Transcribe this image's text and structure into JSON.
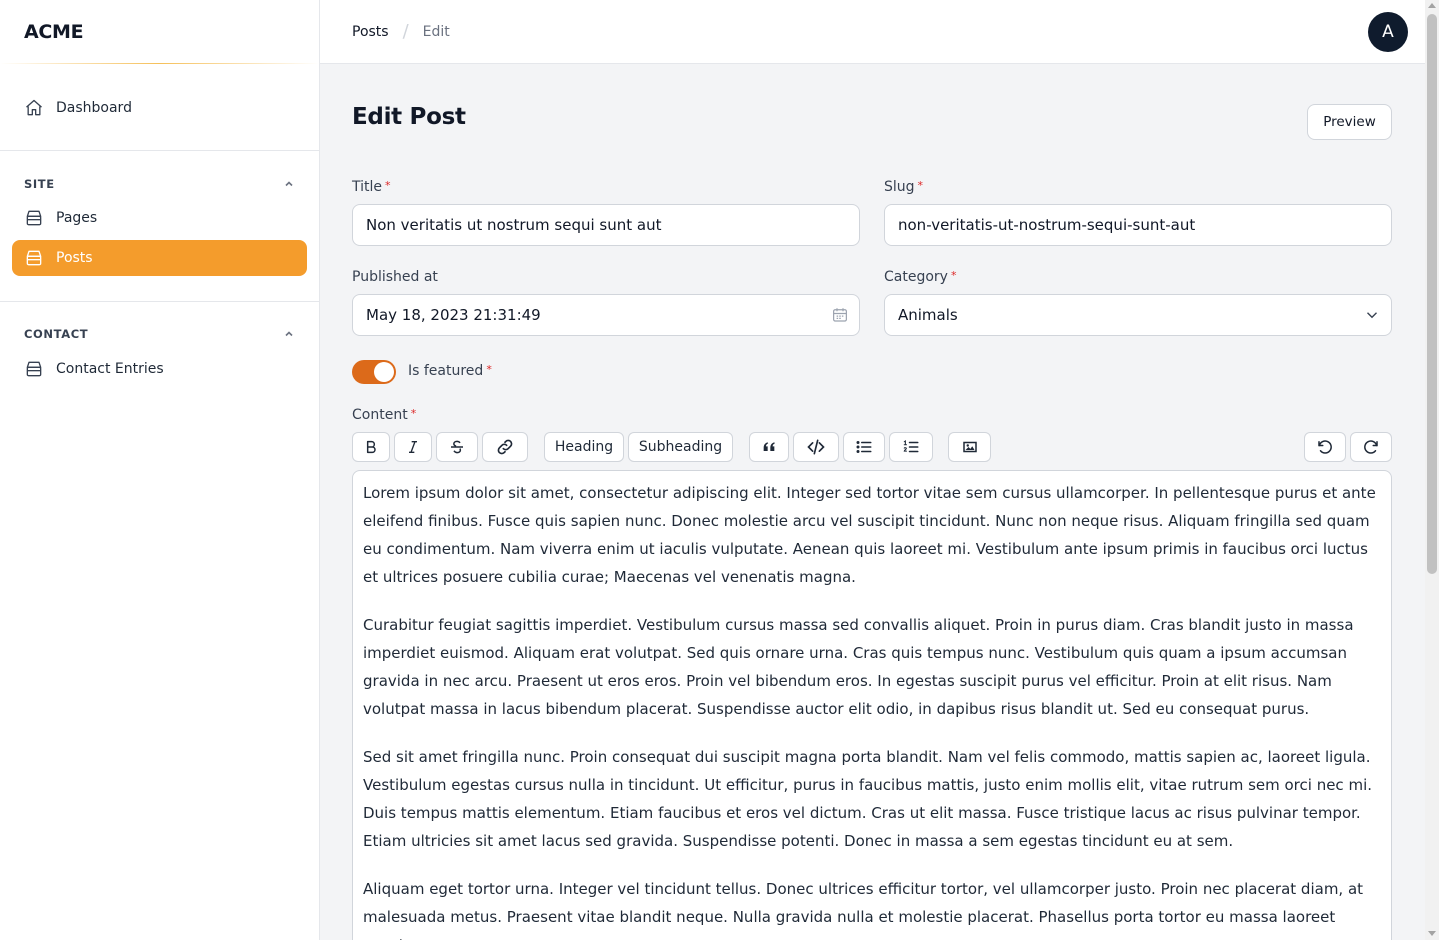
{
  "brand": "ACME",
  "sidebar": {
    "top_items": [
      {
        "label": "Dashboard",
        "icon": "home-icon"
      }
    ],
    "groups": [
      {
        "label": "SITE",
        "items": [
          {
            "label": "Pages",
            "icon": "archive-icon"
          },
          {
            "label": "Posts",
            "icon": "archive-icon",
            "active": true
          }
        ]
      },
      {
        "label": "CONTACT",
        "items": [
          {
            "label": "Contact Entries",
            "icon": "archive-icon"
          }
        ]
      }
    ]
  },
  "breadcrumb": {
    "items": [
      "Posts",
      "Edit"
    ]
  },
  "user": {
    "avatar_initial": "A"
  },
  "page": {
    "title": "Edit Post",
    "preview_label": "Preview"
  },
  "form": {
    "title": {
      "label": "Title",
      "value": "Non veritatis ut nostrum sequi sunt aut"
    },
    "slug": {
      "label": "Slug",
      "value": "non-veritatis-ut-nostrum-sequi-sunt-aut"
    },
    "published_at": {
      "label": "Published at",
      "value": "May 18, 2023 21:31:49"
    },
    "category": {
      "label": "Category",
      "value": "Animals"
    },
    "is_featured": {
      "label": "Is featured",
      "value": true
    },
    "content": {
      "label": "Content",
      "toolbar": {
        "heading_label": "Heading",
        "subheading_label": "Subheading"
      },
      "paragraphs": [
        "Lorem ipsum dolor sit amet, consectetur adipiscing elit. Integer sed tortor vitae sem cursus ullamcorper. In pellentesque purus et ante eleifend finibus. Fusce quis sapien nunc. Donec molestie arcu vel suscipit tincidunt. Nunc non neque risus. Aliquam fringilla sed quam eu condimentum. Nam viverra enim ut iaculis vulputate. Aenean quis laoreet mi. Vestibulum ante ipsum primis in faucibus orci luctus et ultrices posuere cubilia curae; Maecenas vel venenatis magna.",
        "Curabitur feugiat sagittis imperdiet. Vestibulum cursus massa sed convallis aliquet. Proin in purus diam. Cras blandit justo in massa imperdiet euismod. Aliquam erat volutpat. Sed quis ornare urna. Cras quis tempus nunc. Vestibulum quis quam a ipsum accumsan gravida in nec arcu. Praesent ut eros eros. Proin vel bibendum eros. In egestas suscipit purus vel efficitur. Proin at elit risus. Nam volutpat massa in lacus bibendum placerat. Suspendisse auctor elit odio, in dapibus risus blandit ut. Sed eu consequat purus.",
        "Sed sit amet fringilla nunc. Proin consequat dui suscipit magna porta blandit. Nam vel felis commodo, mattis sapien ac, laoreet ligula. Vestibulum egestas cursus nulla in tincidunt. Ut efficitur, purus in faucibus mattis, justo enim mollis elit, vitae rutrum sem orci nec mi. Duis tempus mattis elementum. Etiam faucibus et eros vel dictum. Cras ut elit massa. Fusce tristique lacus ac risus pulvinar tempor. Etiam ultricies sit amet lacus sed gravida. Suspendisse potenti. Donec in massa a sem egestas tincidunt eu at sem.",
        "Aliquam eget tortor urna. Integer vel tincidunt tellus. Donec ultrices efficitur tortor, vel ullamcorper justo. Proin nec placerat diam, at malesuada metus. Praesent vitae blandit neque. Nulla gravida nulla et molestie placerat. Phasellus porta tortor eu massa laoreet egestas."
      ]
    }
  },
  "colors": {
    "accent": "#f49c2c",
    "toggle_on": "#dc6a1a",
    "required": "#dc2626"
  }
}
